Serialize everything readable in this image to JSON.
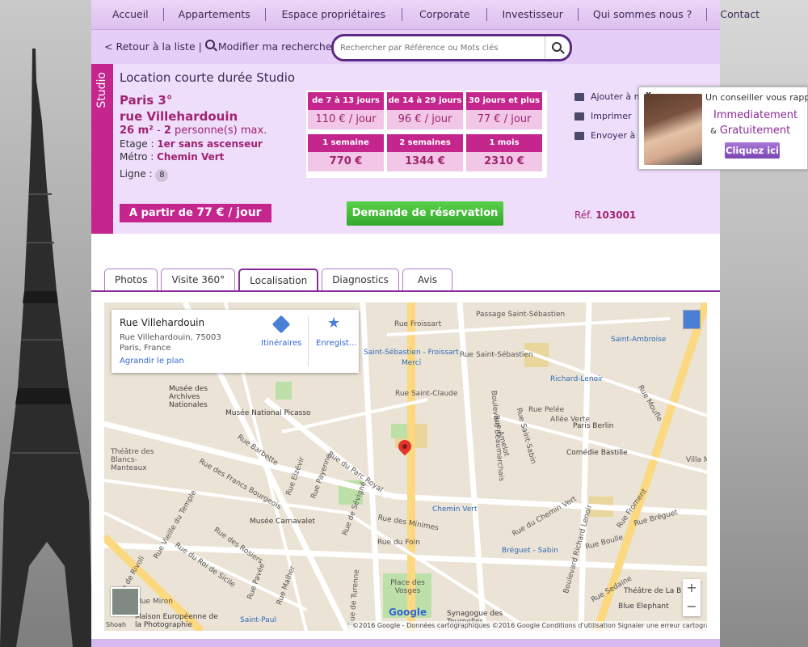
{
  "nav": {
    "items": [
      "Accueil",
      "Appartements",
      "Espace propriétaires",
      "Corporate",
      "Investisseur",
      "Qui sommes nous ?",
      "Contact"
    ]
  },
  "searchbar": {
    "back_label": "< Retour à la liste |",
    "modify_label": "Modifier ma recherche",
    "placeholder": "Rechercher par Référence ou Mots clés"
  },
  "listing": {
    "type_tag": "Studio",
    "title": "Location courte durée Studio",
    "city": "Paris 3°",
    "street": "rue Villehardouin",
    "surface_text": "26 m²",
    "persons_sep": " - ",
    "persons": "2",
    "persons_label": " personne(s) max.",
    "etage_label": "Etage : ",
    "etage_value": "1er sans ascenseur",
    "metro_label": "Métro : ",
    "metro_value": "Chemin Vert",
    "ligne_label": "Ligne :",
    "ligne_value": "8",
    "from_label": "A partir de ",
    "from_value": "77 € / jour",
    "reservation_button": "Demande de réservation",
    "ref_label": "Réf. ",
    "ref_value": "103001"
  },
  "prices": {
    "row1_headers": [
      "de 7 à 13 jours",
      "de 14 à 29 jours",
      "30 jours et plus"
    ],
    "row1_values": [
      "110 € / jour",
      "96 € / jour",
      "77 € / jour"
    ],
    "row2_headers": [
      "1 semaine",
      "2 semaines",
      "1 mois"
    ],
    "row2_values": [
      "770 €",
      "1344 €",
      "2310 €"
    ]
  },
  "actions": {
    "add": "Ajouter à ma",
    "print": "Imprimer",
    "send": "Envoyer à un"
  },
  "callback": {
    "close": "x",
    "line1": "Un conseiller vous rappelle",
    "line2": "Immediatement",
    "amp": "&",
    "line3": "Gratuitement",
    "button": "Cliquez ici"
  },
  "tabs": [
    "Photos",
    "Visite 360°",
    "Localisation",
    "Diagnostics",
    "Avis"
  ],
  "active_tab": "Localisation",
  "map": {
    "info_title": "Rue Villehardouin",
    "info_address": "Rue Villehardouin, 75003 Paris, France",
    "info_link": "Agrandir le plan",
    "directions": "Itinéraires",
    "save": "Enregist...",
    "attribution": "©2016 Google - Données cartographiques ©2016 Google     Conditions d'utilisation     Signaler une erreur cartographique",
    "logo": "Google",
    "labels": [
      "Rue Froissart",
      "Passage Saint-Sébastien",
      "Saint-Sébastien - Froissart",
      "Merci",
      "Rue Saint-Sébastien",
      "Saint-Ambroise",
      "Richard-Lenoir",
      "Rue Saint-Claude",
      "Boulevard Beaumarchais",
      "Rue Pelée",
      "Allée Verte",
      "Paris Berlin",
      "Comédie Bastille",
      "Rue Amelot",
      "Rue Saint-Sabin",
      "Musée des Archives Nationales",
      "Musée National Picasso",
      "Théâtre des Blancs-Manteaux",
      "Rue Barbette",
      "Rue des Francs Bourgeois",
      "Rue Elzévir",
      "Rue Payenne",
      "Rue du Parc Royal",
      "Rue de Sévigné",
      "Chemin Vert",
      "Rue du Chemin Vert",
      "Rue des Minimes",
      "Rue du Foin",
      "Musée Carnavalet",
      "Rue des Rosiers",
      "Rue du Roi de Sicile",
      "Rue Vieille du Temple",
      "Rue Pavée",
      "Rue Malher",
      "Saint-Paul",
      "Place des Vosges",
      "Synagogue des Tournelles",
      "Bréguet - Sabin",
      "Boulevard Richard Lenoir",
      "Rue Froment",
      "Rue Boulle",
      "Rue Bréguet",
      "Rue Sedaine",
      "Théâtre de La B",
      "Blue Elephant",
      "Maison Européenne de la Photographie",
      "Rue Miron",
      "Rue de Rivoli",
      "Rue de Turenne",
      "Villa M",
      "Rue Moufle",
      "Rue du Roi de Sicile"
    ],
    "shoah": "Shoah"
  },
  "colors": {
    "brand_magenta": "#c4268e",
    "nav_bg": "#e6cff6",
    "listing_bg": "#eeddfb",
    "button_green": "#3cb532",
    "accent_purple": "#8a2b9a"
  }
}
